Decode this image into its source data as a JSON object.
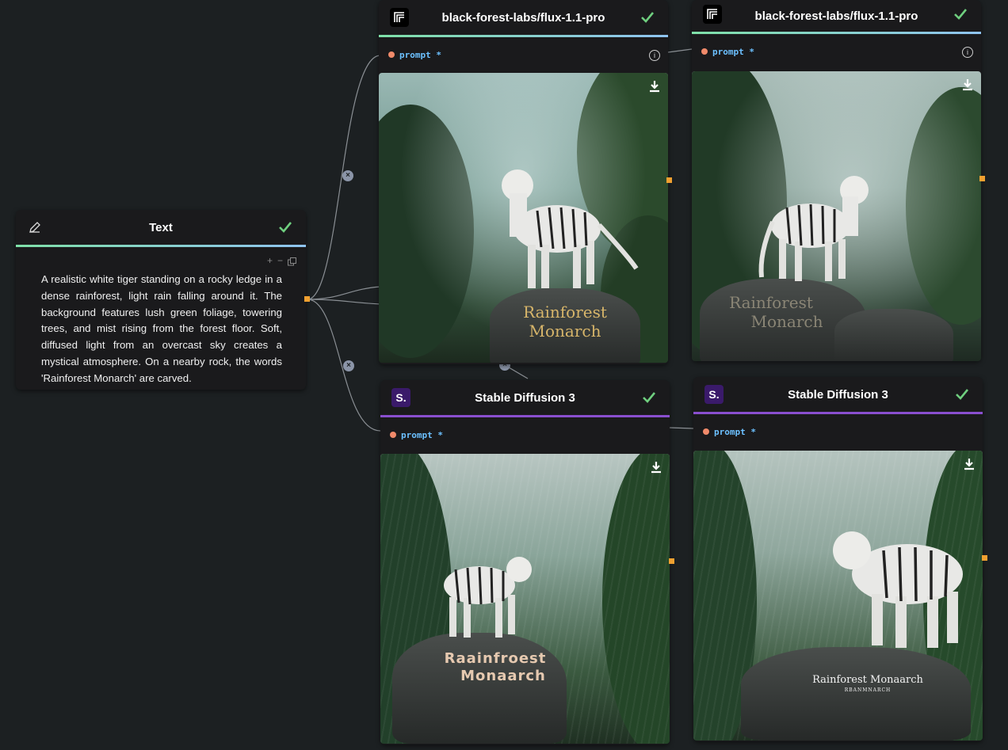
{
  "text_node": {
    "title": "Text",
    "icon": "pencil-icon",
    "body": "A realistic white tiger standing on a rocky ledge in a dense rainforest, light rain falling around it. The background features lush green foliage, towering trees, and mist rising from the forest floor. Soft, diffused light from an overcast sky creates a mystical atmosphere. On a nearby rock, the words 'Rainforest Monarch' are carved.",
    "tools": {
      "add": "+",
      "remove": "−"
    }
  },
  "flux_nodes": [
    {
      "title": "black-forest-labs/flux-1.1-pro",
      "prompt_label": "prompt *",
      "info": "i",
      "carving_line1": "Rainforest",
      "carving_line2": "Monarch"
    },
    {
      "title": "black-forest-labs/flux-1.1-pro",
      "prompt_label": "prompt *",
      "info": "i",
      "carving_line1": "Rainforest",
      "carving_line2": "Monarch"
    }
  ],
  "sd_nodes": [
    {
      "title": "Stable Diffusion 3",
      "logo": "S.",
      "prompt_label": "prompt *",
      "carving_line1": "Raainfroest",
      "carving_line2": "Monaarch"
    },
    {
      "title": "Stable Diffusion 3",
      "logo": "S.",
      "prompt_label": "prompt *",
      "carving_line1": "Rainforest Monaarch",
      "carving_line2": "RBANMNARCH"
    }
  ],
  "wire_marker": "×",
  "colors": {
    "canvas": "#1c2022",
    "node_bg": "#1a1a1c",
    "check": "#6fcf7f",
    "flux_bar": "#7fe0a8",
    "sd_bar": "#8a4fcf",
    "port": "#f0a030",
    "prompt_dot": "#f08a6a",
    "prompt_text": "#6cc0ff"
  }
}
